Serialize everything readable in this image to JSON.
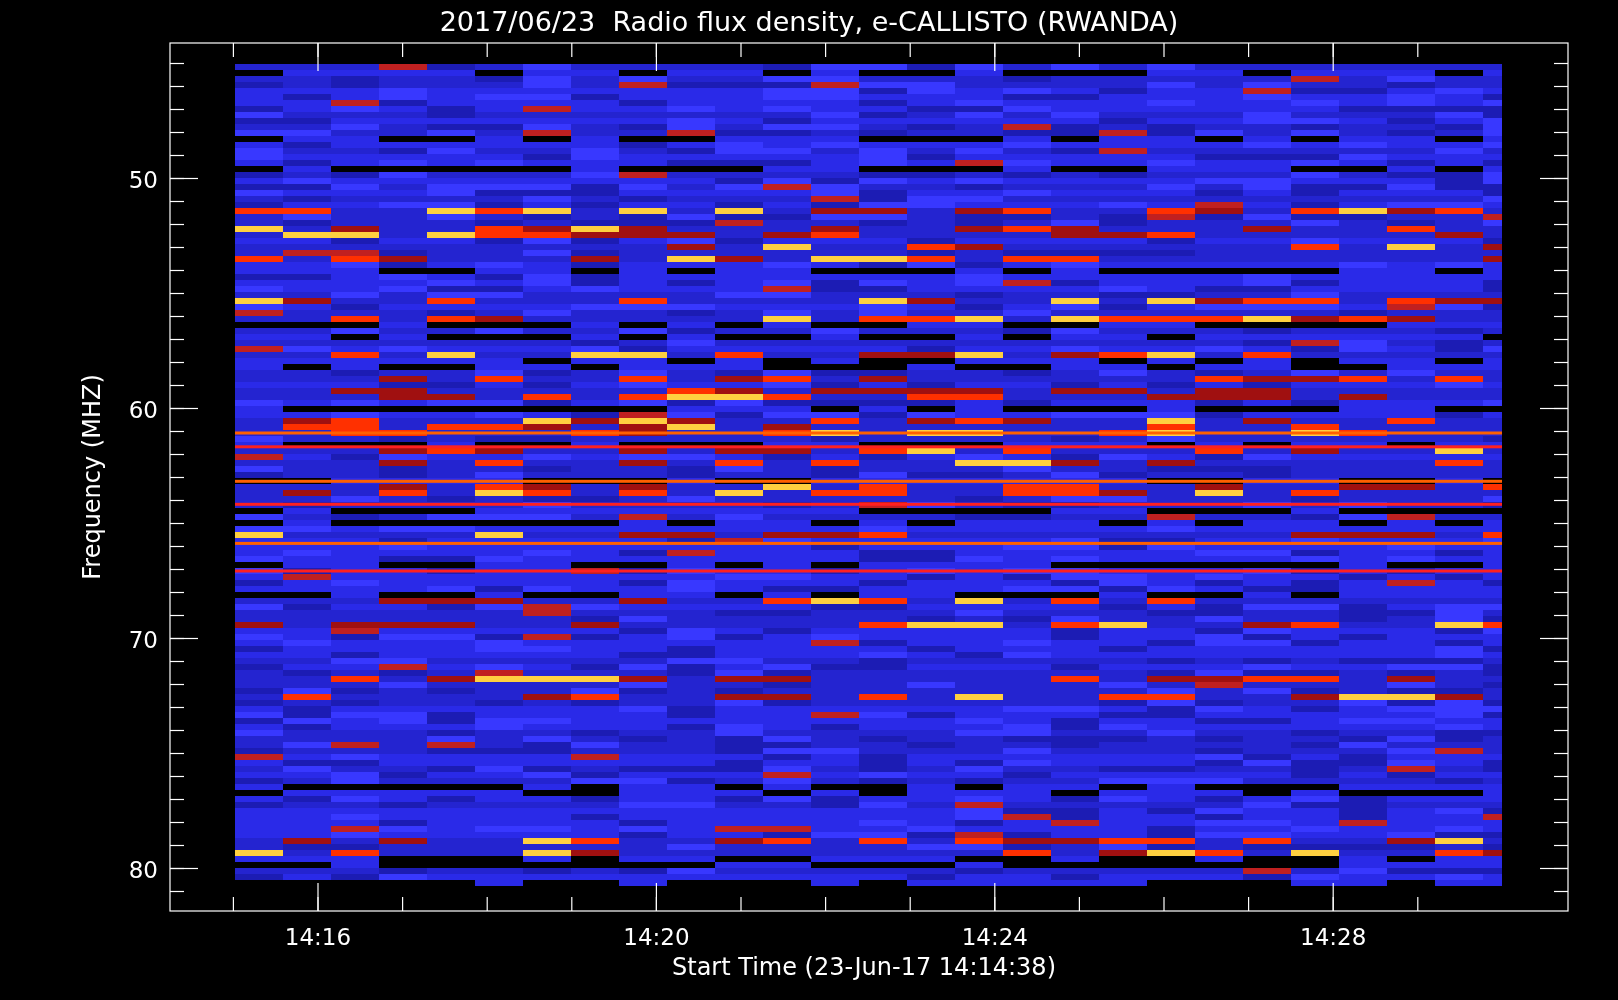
{
  "title": "2017/06/23  Radio flux density, e-CALLISTO (RWANDA)",
  "ylabel": "Frequency (MHZ)",
  "xlabel": "Start Time (23-Jun-17 14:14:38)",
  "yticks": [
    "50",
    "60",
    "70",
    "80"
  ],
  "xticks": [
    "14:16",
    "14:20",
    "14:24",
    "14:28"
  ]
}
